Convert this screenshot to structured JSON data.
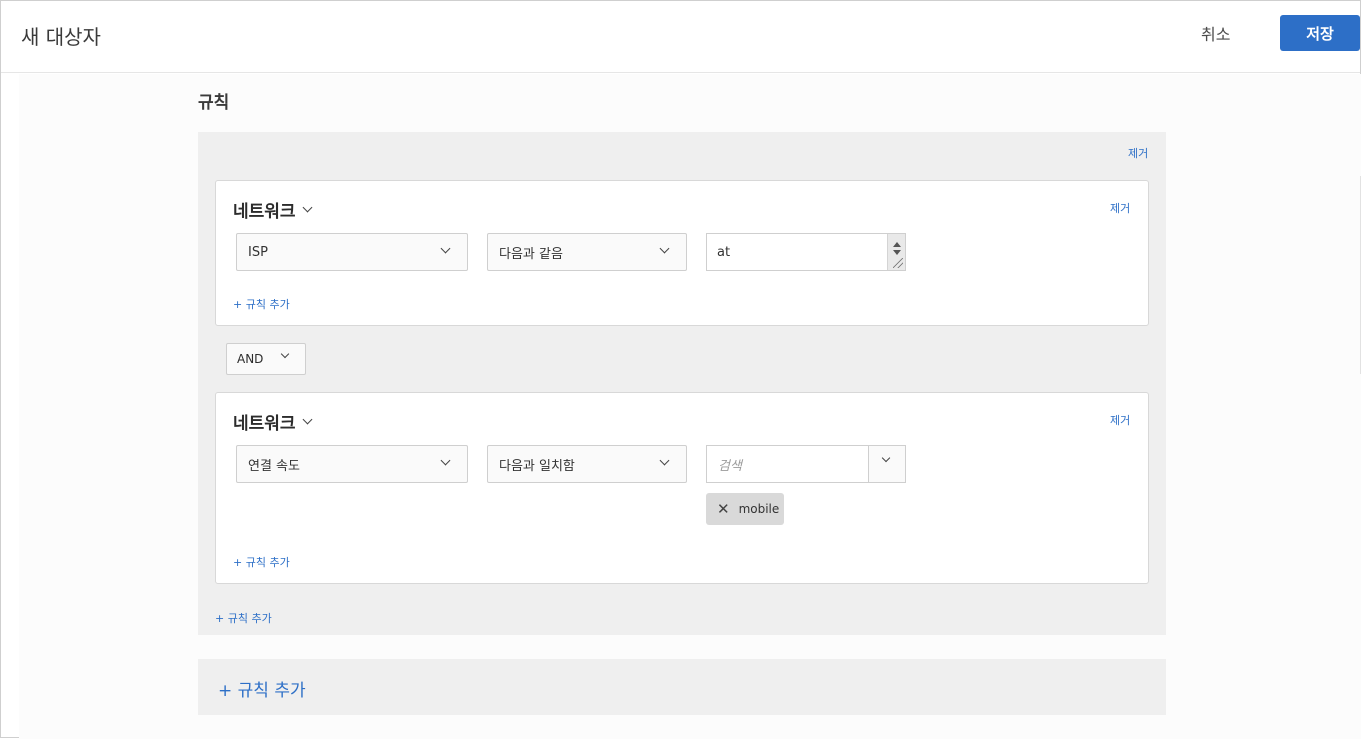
{
  "header": {
    "title": "새 대상자",
    "cancel_label": "취소",
    "save_label": "저장"
  },
  "section": {
    "title": "규칙"
  },
  "group": {
    "remove_label": "제거",
    "add_rule_label": "+ 규칙 추가",
    "conjunction": "AND",
    "rules": [
      {
        "category": "네트워크",
        "remove_label": "제거",
        "attribute": "ISP",
        "operator": "다음과 같음",
        "value": "at",
        "add_rule_label": "+ 규칙 추가"
      },
      {
        "category": "네트워크",
        "remove_label": "제거",
        "attribute": "연결 속도",
        "operator": "다음과 일치함",
        "search_placeholder": "검색",
        "tags": [
          "mobile"
        ],
        "tag_remove_glyph": "✕",
        "add_rule_label": "+ 규칙 추가"
      }
    ]
  },
  "footer": {
    "add_rule_label": "+ 규칙 추가"
  },
  "colors": {
    "accent": "#2d6fc7",
    "group_bg": "#efefef",
    "tag_bg": "#d9d9d9"
  }
}
